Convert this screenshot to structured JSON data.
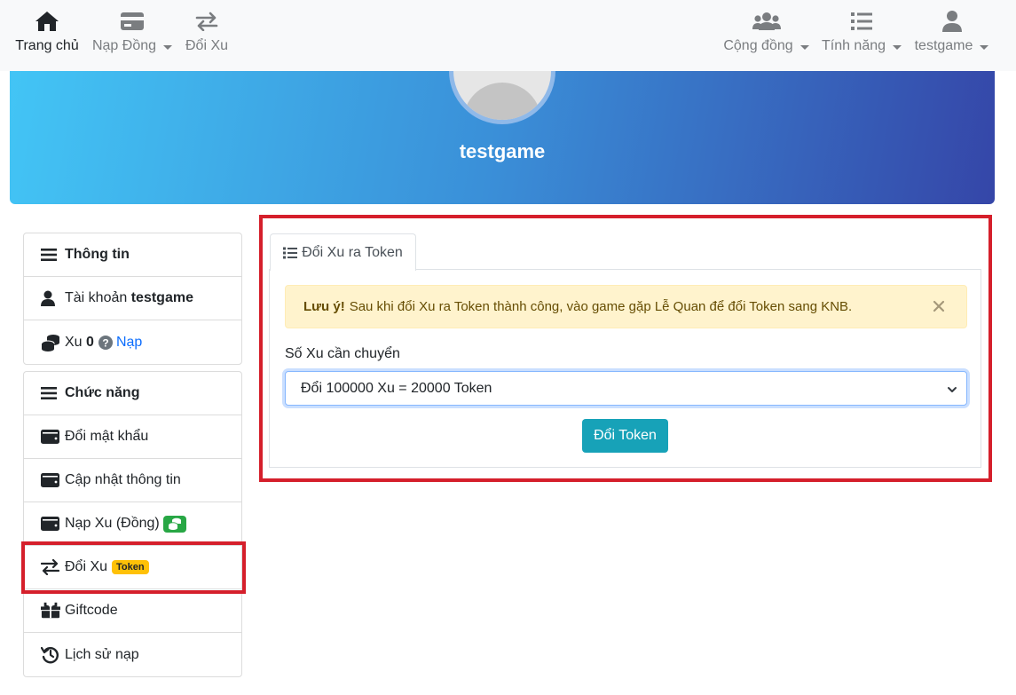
{
  "navbar": {
    "items": [
      {
        "label": "Trang chủ",
        "icon": "home-icon",
        "active": true
      },
      {
        "label": "Nạp Đồng",
        "icon": "card-icon",
        "dropdown": true
      },
      {
        "label": "Đổi Xu",
        "icon": "exchange-icon"
      }
    ],
    "right_items": [
      {
        "label": "Cộng đồng",
        "icon": "users-icon",
        "dropdown": true
      },
      {
        "label": "Tính năng",
        "icon": "list-icon",
        "dropdown": true
      },
      {
        "label": "testgame",
        "icon": "user-icon",
        "dropdown": true
      }
    ]
  },
  "banner": {
    "username": "testgame"
  },
  "sidebar": {
    "info": {
      "header": "Thông tin",
      "account_label": "Tài khoản",
      "account_name": "testgame",
      "xu_label": "Xu",
      "xu_value": "0",
      "topup_link": "Nạp"
    },
    "functions": {
      "header": "Chức năng",
      "items": [
        {
          "label": "Đổi mật khẩu",
          "icon": "wallet-icon"
        },
        {
          "label": "Cập nhật thông tin",
          "icon": "wallet-icon"
        },
        {
          "label": "Nạp Xu (Đồng)",
          "icon": "wallet-icon",
          "badge_icon": "coins-icon"
        },
        {
          "label": "Đổi Xu",
          "icon": "exchange-icon",
          "badge": "Token"
        },
        {
          "label": "Giftcode",
          "icon": "gift-icon"
        },
        {
          "label": "Lịch sử nạp",
          "icon": "history-icon"
        }
      ]
    }
  },
  "main": {
    "tab_label": "Đổi Xu ra Token",
    "alert": {
      "strong": "Lưu ý!",
      "text": "Sau khi đổi Xu ra Token thành công, vào game gặp Lễ Quan để đổi Token sang KNB."
    },
    "field_label": "Số Xu cần chuyển",
    "select_value": "Đổi 100000 Xu = 20000 Token",
    "submit_label": "Đổi Token"
  },
  "colors": {
    "highlight": "#d51f2b",
    "button": "#17a2b8",
    "alert_bg": "#fff3cd",
    "token_badge": "#ffc107",
    "link": "#0d6efd"
  }
}
